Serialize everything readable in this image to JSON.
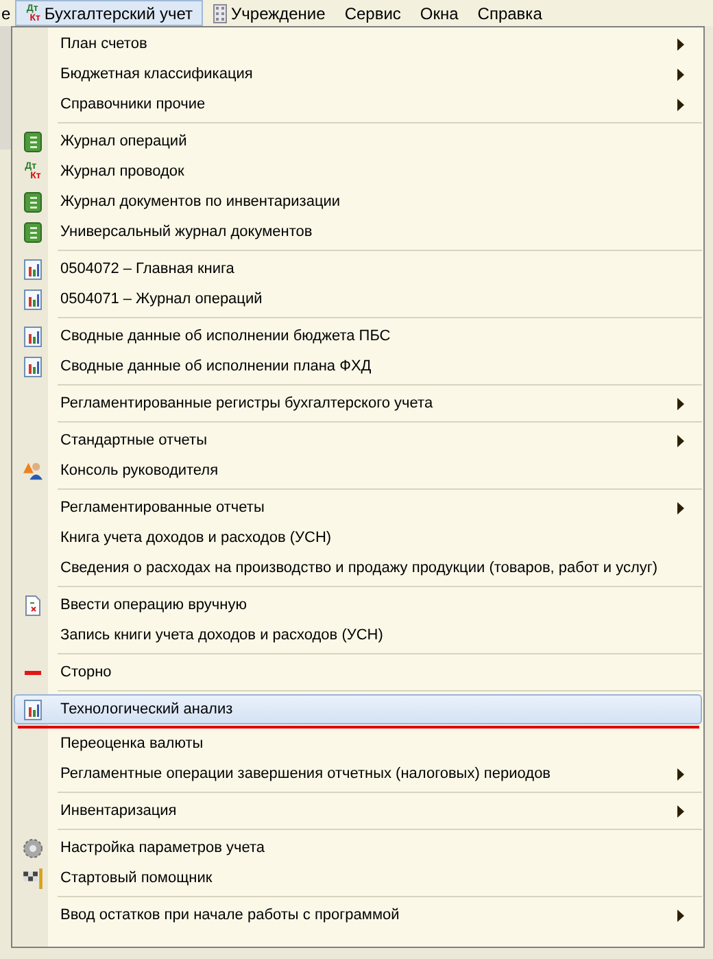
{
  "menu_bar": [
    {
      "label": "е",
      "kind": "plain",
      "selected": false
    },
    {
      "label": "Бухгалтерский учет",
      "kind": "dtkt",
      "icon_text": [
        "Дт",
        "Кт"
      ],
      "selected": true
    },
    {
      "label": "Учреждение",
      "kind": "building",
      "selected": false
    },
    {
      "label": "Сервис",
      "kind": "plain",
      "selected": false
    },
    {
      "label": "Окна",
      "kind": "plain",
      "selected": false
    },
    {
      "label": "Справка",
      "kind": "plain",
      "selected": false
    }
  ],
  "menu": {
    "groups": [
      [
        {
          "label": "План счетов",
          "kind": "plain",
          "submenu": true,
          "selected": false,
          "underlined": false
        },
        {
          "label": "Бюджетная классификация",
          "kind": "plain",
          "submenu": true,
          "selected": false,
          "underlined": false
        },
        {
          "label": "Справочники прочие",
          "kind": "plain",
          "submenu": true,
          "selected": false,
          "underlined": false
        }
      ],
      [
        {
          "label": "Журнал операций",
          "kind": "journal",
          "submenu": false,
          "selected": false,
          "underlined": false
        },
        {
          "label": "Журнал проводок",
          "kind": "dtkt",
          "icon_text": [
            "Дт",
            "Кт"
          ],
          "submenu": false,
          "selected": false,
          "underlined": false
        },
        {
          "label": "Журнал документов по инвентаризации",
          "kind": "journal",
          "submenu": false,
          "selected": false,
          "underlined": false
        },
        {
          "label": "Универсальный журнал документов",
          "kind": "journal",
          "submenu": false,
          "selected": false,
          "underlined": false
        }
      ],
      [
        {
          "label": "0504072  –  Главная книга",
          "kind": "report",
          "submenu": false,
          "selected": false,
          "underlined": false
        },
        {
          "label": "0504071  –  Журнал операций",
          "kind": "report",
          "submenu": false,
          "selected": false,
          "underlined": false
        }
      ],
      [
        {
          "label": "Сводные данные об исполнении бюджета ПБС",
          "kind": "report",
          "submenu": false,
          "selected": false,
          "underlined": false
        },
        {
          "label": "Сводные данные об исполнении плана ФХД",
          "kind": "report",
          "submenu": false,
          "selected": false,
          "underlined": false
        }
      ],
      [
        {
          "label": "Регламентированные регистры бухгалтерского учета",
          "kind": "plain",
          "submenu": true,
          "selected": false,
          "underlined": false
        }
      ],
      [
        {
          "label": "Стандартные отчеты",
          "kind": "plain",
          "submenu": true,
          "selected": false,
          "underlined": false
        },
        {
          "label": "Консоль руководителя",
          "kind": "console",
          "submenu": false,
          "selected": false,
          "underlined": false
        }
      ],
      [
        {
          "label": "Регламентированные отчеты",
          "kind": "plain",
          "submenu": true,
          "selected": false,
          "underlined": false
        },
        {
          "label": "Книга учета доходов и расходов (УСН)",
          "kind": "plain",
          "submenu": false,
          "selected": false,
          "underlined": false
        },
        {
          "label": "Сведения о расходах на производство и продажу продукции (товаров, работ и услуг)",
          "kind": "plain",
          "submenu": false,
          "selected": false,
          "underlined": false
        }
      ],
      [
        {
          "label": "Ввести операцию вручную",
          "kind": "manual",
          "submenu": false,
          "selected": false,
          "underlined": false
        },
        {
          "label": "Запись книги учета доходов и расходов (УСН)",
          "kind": "plain",
          "submenu": false,
          "selected": false,
          "underlined": false
        }
      ],
      [
        {
          "label": "Сторно",
          "kind": "storno",
          "submenu": false,
          "selected": false,
          "underlined": false
        }
      ],
      [
        {
          "label": "Технологический анализ",
          "kind": "report",
          "submenu": false,
          "selected": true,
          "underlined": true
        },
        {
          "label": "Переоценка валюты",
          "kind": "plain",
          "submenu": false,
          "selected": false,
          "underlined": false
        },
        {
          "label": "Регламентные операции завершения отчетных (налоговых) периодов",
          "kind": "plain",
          "submenu": true,
          "selected": false,
          "underlined": false
        }
      ],
      [
        {
          "label": "Инвентаризация",
          "kind": "plain",
          "submenu": true,
          "selected": false,
          "underlined": false
        }
      ],
      [
        {
          "label": "Настройка параметров учета",
          "kind": "gear",
          "submenu": false,
          "selected": false,
          "underlined": false
        },
        {
          "label": "Стартовый помощник",
          "kind": "flag",
          "submenu": false,
          "selected": false,
          "underlined": false
        }
      ],
      [
        {
          "label": "Ввод остатков при начале работы с программой",
          "kind": "plain",
          "submenu": true,
          "selected": false,
          "underlined": false
        }
      ]
    ]
  }
}
